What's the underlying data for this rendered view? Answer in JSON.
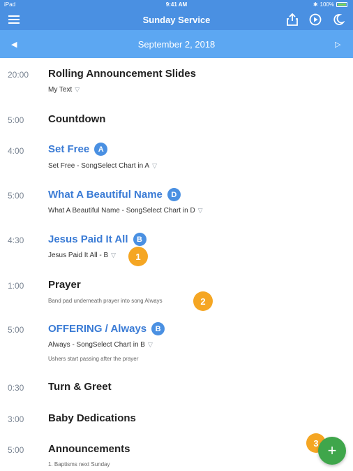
{
  "status_bar": {
    "carrier": "iPad",
    "time": "9:41 AM",
    "battery_text": "100%"
  },
  "header": {
    "title": "Sunday Service",
    "icons": [
      "menu-icon",
      "share-icon",
      "play-icon",
      "moon-icon"
    ]
  },
  "date_bar": {
    "date": "September 2, 2018",
    "icons": [
      "prev-arrow-icon",
      "next-arrow-icon"
    ]
  },
  "items": [
    {
      "duration": "20:00",
      "title": "Rolling Announcement Slides",
      "subtitle": "My Text"
    },
    {
      "duration": "5:00",
      "title": "Countdown"
    },
    {
      "duration": "4:00",
      "title": "Set Free",
      "key": "A",
      "subtitle": "Set Free - SongSelect Chart in A"
    },
    {
      "duration": "5:00",
      "title": "What A Beautiful Name",
      "key": "D",
      "subtitle": "What A Beautiful Name - SongSelect Chart in D"
    },
    {
      "duration": "4:30",
      "title": "Jesus Paid It All",
      "key": "B",
      "subtitle": "Jesus Paid It All - B"
    },
    {
      "duration": "1:00",
      "title": "Prayer",
      "note": "Band pad underneath prayer into song Always"
    },
    {
      "duration": "5:00",
      "title": "OFFERING / Always",
      "key": "B",
      "subtitle": "Always - SongSelect Chart in B",
      "note": "Ushers start passing after the prayer"
    },
    {
      "duration": "0:30",
      "title": "Turn & Greet"
    },
    {
      "duration": "3:00",
      "title": "Baby Dedications"
    },
    {
      "duration": "5:00",
      "title": "Announcements",
      "note": "1. Baptisms next Sunday"
    }
  ],
  "callouts": [
    "1",
    "2",
    "3"
  ],
  "fab": {
    "label": "+"
  },
  "colors": {
    "header": "#4a90e2",
    "date_bar": "#5ca7f2",
    "song_title": "#3a7bd5",
    "key_badge": "#4a90e2",
    "callout": "#f5a623",
    "fab": "#3fa64b"
  }
}
